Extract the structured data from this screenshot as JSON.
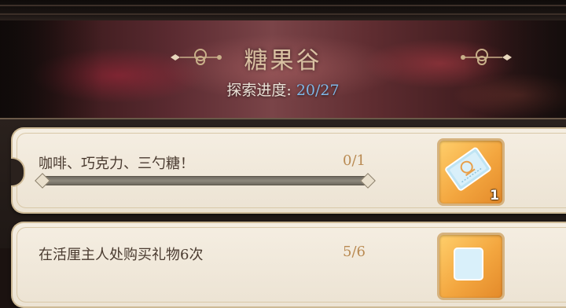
{
  "region": {
    "title": "糖果谷",
    "progress_label": "探索进度:",
    "progress_value": "20/27"
  },
  "quests": [
    {
      "name": "咖啡、巧克力、三勺糖！",
      "count": "0/1",
      "progress_fraction": 0,
      "reward_icon": "ticket-icon",
      "reward_qty": "1"
    },
    {
      "name": "在活厘主人处购买礼物6次",
      "count": "5/6",
      "progress_fraction": 0.83,
      "reward_icon": "reward-icon",
      "reward_qty": ""
    }
  ],
  "colors": {
    "title": "#d9c1a2",
    "progress_value": "#7fb8e8",
    "count": "#b98a52",
    "reward_bg": "#f3a63f"
  }
}
